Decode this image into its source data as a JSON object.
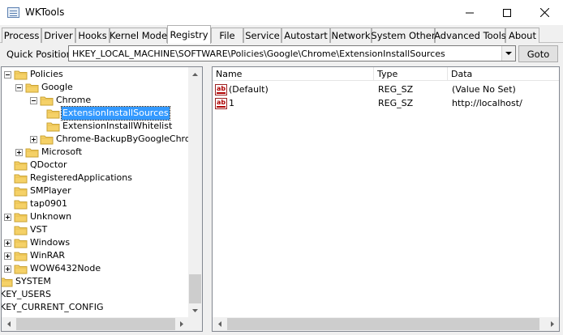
{
  "window": {
    "title": "WKTools",
    "controls": [
      "minimize-icon",
      "maximize-icon",
      "close-icon"
    ]
  },
  "tabs": [
    {
      "label": "Process"
    },
    {
      "label": "Driver"
    },
    {
      "label": "Hooks"
    },
    {
      "label": "Kernel Mode"
    },
    {
      "label": "Registry",
      "active": true
    },
    {
      "label": "File"
    },
    {
      "label": "Service"
    },
    {
      "label": "Autostart"
    },
    {
      "label": "Network"
    },
    {
      "label": "System Other"
    },
    {
      "label": "Advanced Tools"
    },
    {
      "label": "About"
    }
  ],
  "quick_position": {
    "label": "Quick Position",
    "value": "HKEY_LOCAL_MACHINE\\SOFTWARE\\Policies\\Google\\Chrome\\ExtensionInstallSources",
    "goto_label": "Goto"
  },
  "tree": {
    "items": [
      {
        "label": "Policies",
        "expander": "minus"
      },
      {
        "label": "Google",
        "expander": "minus"
      },
      {
        "label": "Chrome",
        "expander": "minus"
      },
      {
        "label": "ExtensionInstallSources",
        "selected": true
      },
      {
        "label": "ExtensionInstallWhitelist"
      },
      {
        "label": "Chrome-BackupByGoogleChrome",
        "expander": "plus"
      },
      {
        "label": "Microsoft",
        "expander": "plus"
      },
      {
        "label": "QDoctor"
      },
      {
        "label": "RegisteredApplications"
      },
      {
        "label": "SMPlayer"
      },
      {
        "label": "tap0901"
      },
      {
        "label": "Unknown",
        "expander": "plus"
      },
      {
        "label": "VST"
      },
      {
        "label": "Windows",
        "expander": "plus"
      },
      {
        "label": "WinRAR",
        "expander": "plus"
      },
      {
        "label": "WOW6432Node",
        "expander": "plus"
      },
      {
        "label": "SYSTEM"
      },
      {
        "label": "KEY_USERS"
      },
      {
        "label": "KEY_CURRENT_CONFIG"
      }
    ]
  },
  "values_list": {
    "columns": [
      "Name",
      "Type",
      "Data"
    ],
    "rows": [
      {
        "name": "(Default)",
        "type": "REG_SZ",
        "data": "(Value No Set)",
        "icon": "string-value-icon"
      },
      {
        "name": "1",
        "type": "REG_SZ",
        "data": "http://localhost/",
        "icon": "string-value-icon"
      }
    ]
  },
  "colors": {
    "selection": "#3399ff",
    "folder": "#f5d167",
    "window_bg": "#f0f0f0"
  }
}
